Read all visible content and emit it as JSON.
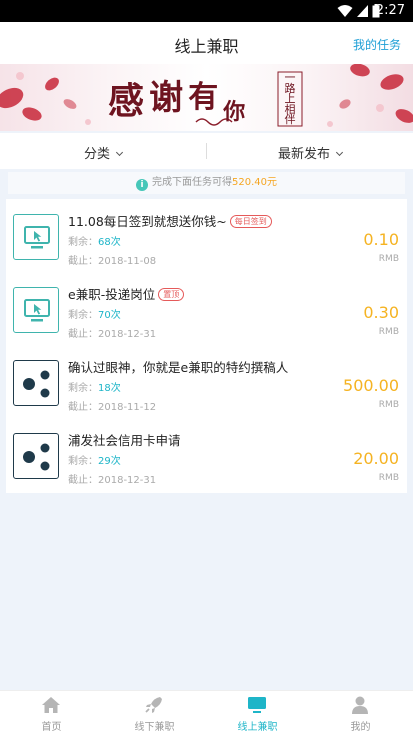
{
  "status_bar": {
    "time": "2:27"
  },
  "header": {
    "title": "线上兼职",
    "action": "我的任务"
  },
  "banner": {
    "headline_chars": [
      "感",
      "谢",
      "有",
      "你"
    ],
    "tagline": "一路上相伴"
  },
  "filters": {
    "category": "分类",
    "sort": "最新发布"
  },
  "notice": {
    "prefix": "完成下面任务可得",
    "amount": "520.40元"
  },
  "tasks": [
    {
      "title": "11.08每日签到就想送你钱~",
      "tag": "每日签到",
      "remain_label": "剩余：",
      "remain": "68次",
      "deadline": "截止：2018-11-08",
      "price": "0.10",
      "unit": "RMB",
      "icon": "monitor-icon"
    },
    {
      "title": "e兼职-投递岗位",
      "tag": "置顶",
      "remain_label": "剩余：",
      "remain": "70次",
      "deadline": "截止：2018-12-31",
      "price": "0.30",
      "unit": "RMB",
      "icon": "monitor-icon"
    },
    {
      "title": "确认过眼神，你就是e兼职的特约撰稿人",
      "tag": "",
      "remain_label": "剩余：",
      "remain": "18次",
      "deadline": "截止：2018-11-12",
      "price": "500.00",
      "unit": "RMB",
      "icon": "share-icon"
    },
    {
      "title": "浦发社会信用卡申请",
      "tag": "",
      "remain_label": "剩余：",
      "remain": "29次",
      "deadline": "截止：2018-12-31",
      "price": "20.00",
      "unit": "RMB",
      "icon": "share-icon"
    }
  ],
  "tabbar": {
    "home": "首页",
    "offline": "线下兼职",
    "online": "线上兼职",
    "mine": "我的"
  },
  "colors": {
    "accent": "#1eb5c8",
    "price": "#f5b322",
    "tag": "#e55a5a",
    "link": "#1e9fd6"
  }
}
